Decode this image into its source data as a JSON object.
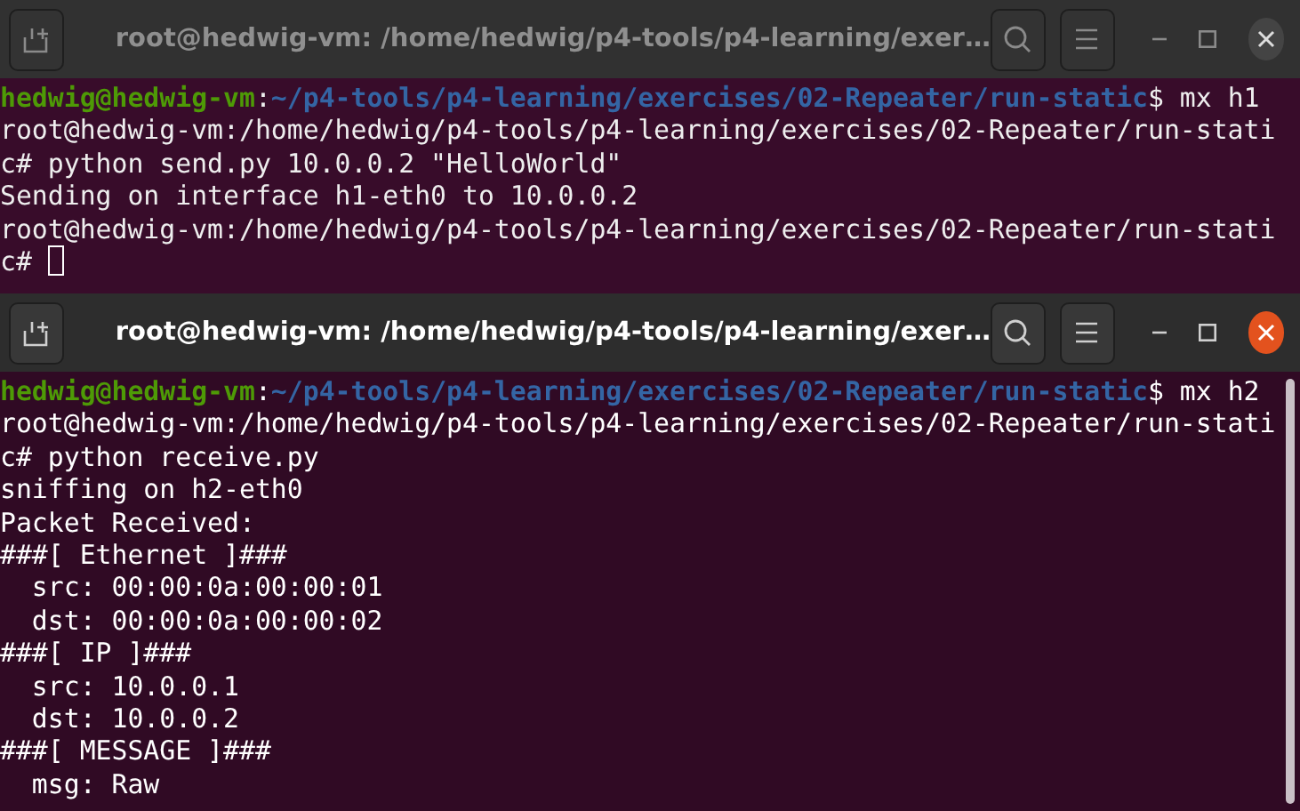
{
  "windows": [
    {
      "title": "root@hedwig-vm: /home/hedwig/p4-tools/p4-learning/exer…",
      "active": false,
      "cursor": true,
      "lines": [
        {
          "kind": "prompt",
          "user": "hedwig@hedwig-vm",
          "sep": ":",
          "path": "~/p4-tools/p4-learning/exercises/02-Repeater/run-static",
          "cmd": "$ mx h1"
        },
        {
          "kind": "plain",
          "text": "root@hedwig-vm:/home/hedwig/p4-tools/p4-learning/exercises/02-Repeater/run-stati"
        },
        {
          "kind": "plain",
          "text": "c# python send.py 10.0.0.2 \"HelloWorld\""
        },
        {
          "kind": "plain",
          "text": "Sending on interface h1-eth0 to 10.0.0.2"
        },
        {
          "kind": "plain",
          "text": "root@hedwig-vm:/home/hedwig/p4-tools/p4-learning/exercises/02-Repeater/run-stati"
        },
        {
          "kind": "plain",
          "text": "c#"
        }
      ]
    },
    {
      "title": "root@hedwig-vm: /home/hedwig/p4-tools/p4-learning/exer…",
      "active": true,
      "cursor": false,
      "lines": [
        {
          "kind": "prompt",
          "user": "hedwig@hedwig-vm",
          "sep": ":",
          "path": "~/p4-tools/p4-learning/exercises/02-Repeater/run-static",
          "cmd": "$ mx h2"
        },
        {
          "kind": "plain",
          "text": "root@hedwig-vm:/home/hedwig/p4-tools/p4-learning/exercises/02-Repeater/run-stati"
        },
        {
          "kind": "plain",
          "text": "c# python receive.py"
        },
        {
          "kind": "plain",
          "text": "sniffing on h2-eth0"
        },
        {
          "kind": "plain",
          "text": "Packet Received:"
        },
        {
          "kind": "plain",
          "text": "###[ Ethernet ]###"
        },
        {
          "kind": "plain",
          "text": "  src: 00:00:0a:00:00:01"
        },
        {
          "kind": "plain",
          "text": "  dst: 00:00:0a:00:00:02"
        },
        {
          "kind": "plain",
          "text": "###[ IP ]###"
        },
        {
          "kind": "plain",
          "text": "  src: 10.0.0.1"
        },
        {
          "kind": "plain",
          "text": "  dst: 10.0.0.2"
        },
        {
          "kind": "plain",
          "text": "###[ MESSAGE ]###"
        },
        {
          "kind": "plain",
          "text": "  msg: Raw"
        }
      ]
    }
  ]
}
